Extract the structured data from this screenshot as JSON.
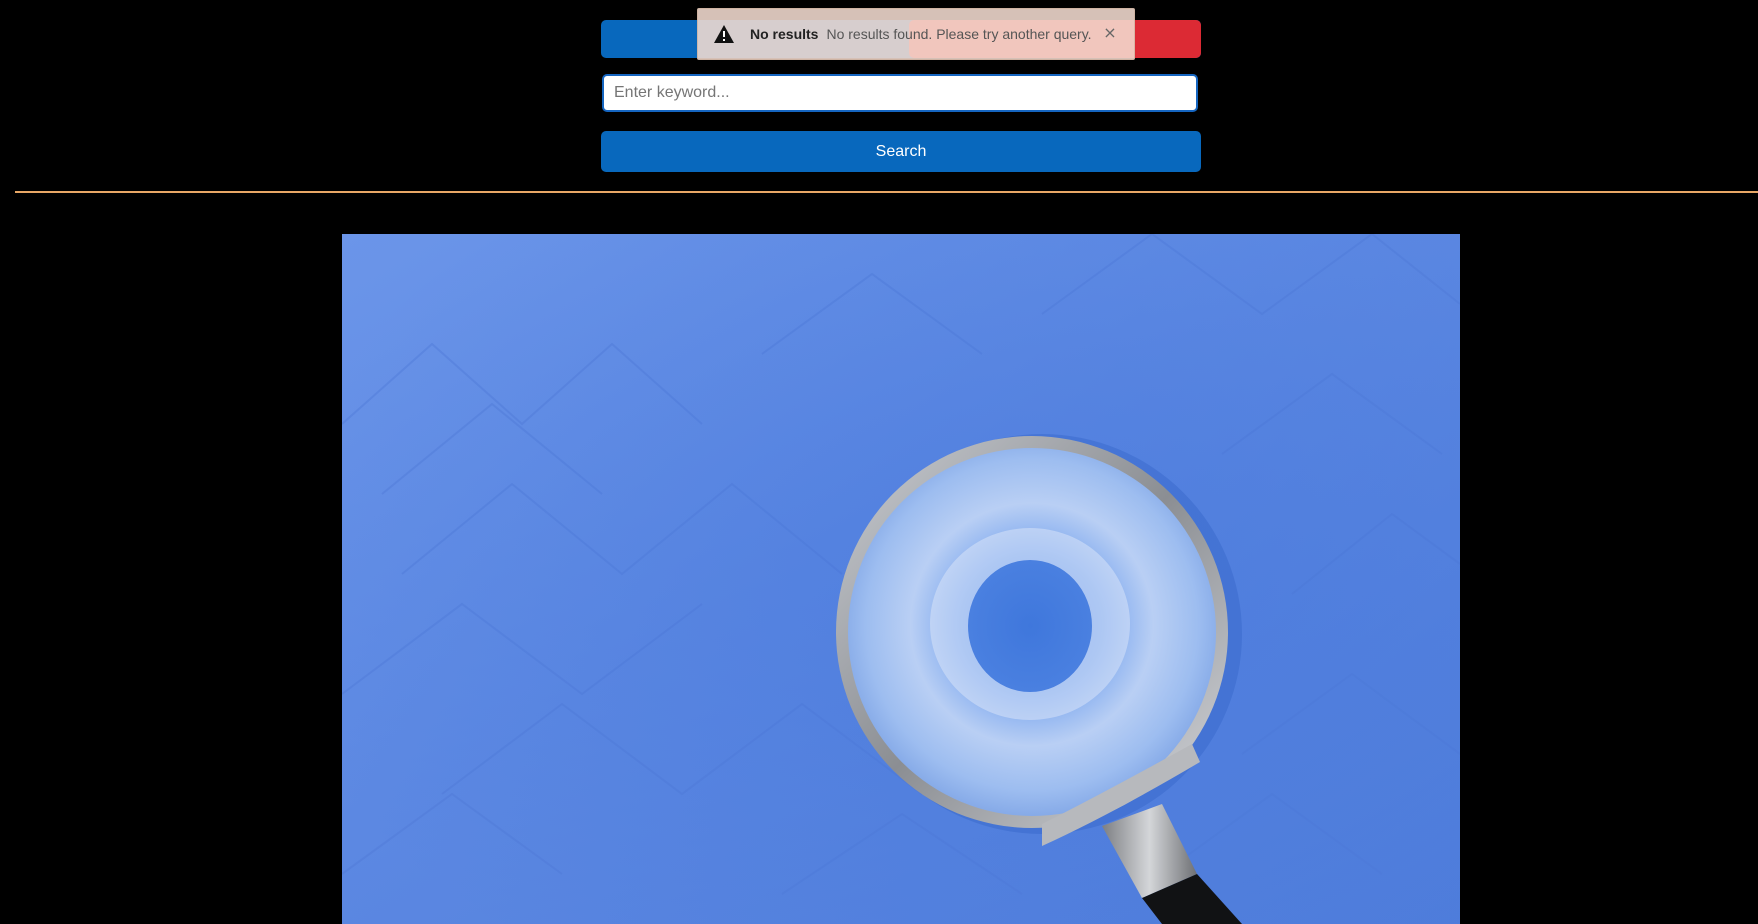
{
  "toast": {
    "title": "No results",
    "message": "No results found. Please try another query.",
    "close_glyph": "×",
    "icon": "warning-icon"
  },
  "search": {
    "placeholder": "Enter keyword...",
    "value": "",
    "button_label": "Search"
  },
  "top_actions": {
    "primary_color": "#0868bd",
    "danger_color": "#dc2a34"
  },
  "hero": {
    "icon": "magnifying-glass-photo"
  },
  "colors": {
    "background": "#000000",
    "accent": "#0868bd",
    "divider": "#e8a766"
  }
}
